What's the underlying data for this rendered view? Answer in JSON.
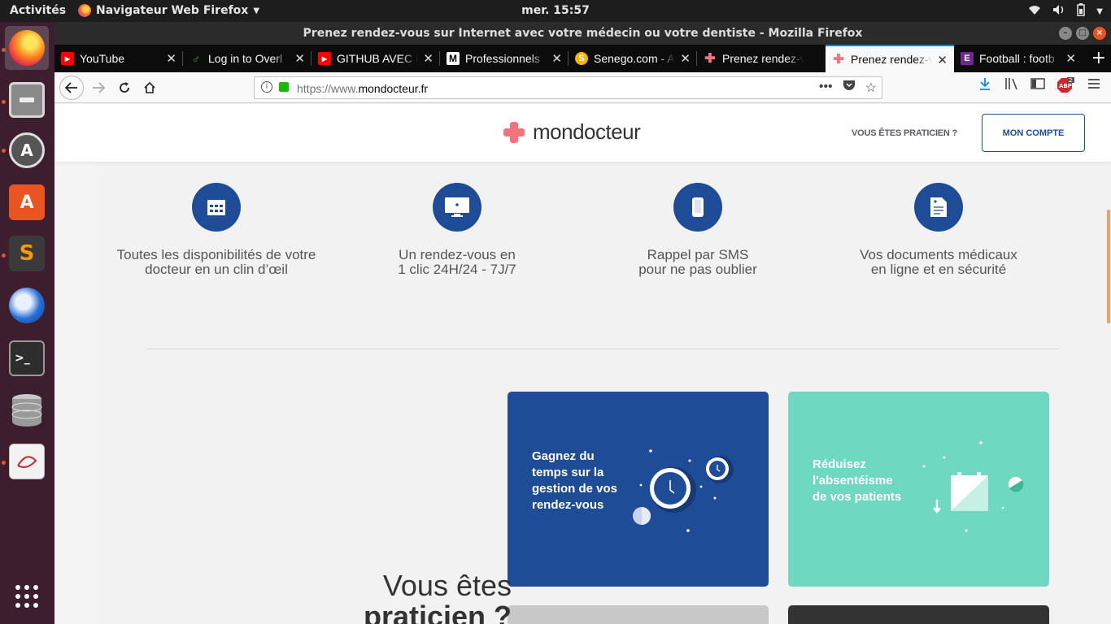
{
  "system": {
    "activities": "Activités",
    "app_menu": "Navigateur Web Firefox",
    "clock": "mer. 15:57"
  },
  "window": {
    "title": "Prenez rendez-vous sur Internet avec votre médecin ou votre dentiste - Mozilla Firefox"
  },
  "tabs": [
    {
      "label": "YouTube",
      "icon": "youtube-icon",
      "color": "#ff0000"
    },
    {
      "label": "Log in to Overl",
      "icon": "overleaf-icon",
      "color": "#4f9c45"
    },
    {
      "label": "GITHUB AVEC L",
      "icon": "youtube-icon",
      "color": "#ff0000"
    },
    {
      "label": "Professionnels",
      "icon": "medium-icon",
      "color": "#ffffff"
    },
    {
      "label": "Senego.com - A",
      "icon": "senego-icon",
      "color": "#f5b800"
    },
    {
      "label": "Prenez rendez-v",
      "icon": "mondocteur-icon",
      "color": "#f4727e"
    },
    {
      "label": "Prenez rendez-v",
      "icon": "mondocteur-icon",
      "color": "#f4727e"
    },
    {
      "label": "Football : footb",
      "icon": "football-icon",
      "color": "#6d2b8f"
    }
  ],
  "url": {
    "prefix": "https://www.",
    "host": "mondocteur.fr"
  },
  "site": {
    "brand": "mondocteur",
    "praticien_link": "VOUS ÊTES PRATICIEN ?",
    "account_button": "MON COMPTE",
    "features": [
      {
        "line1": "Toutes les disponibilités de votre",
        "line2": "docteur en un clin d’œil",
        "icon": "calendar-icon"
      },
      {
        "line1": "Un rendez-vous en",
        "line2": "1 clic 24H/24 - 7J/7",
        "icon": "monitor-icon"
      },
      {
        "line1": "Rappel par SMS",
        "line2": "pour ne pas oublier",
        "icon": "phone-icon"
      },
      {
        "line1": "Vos documents médicaux",
        "line2": "en ligne et en sécurité",
        "icon": "document-icon"
      }
    ],
    "cards": [
      {
        "text": "Gagnez du temps sur la gestion de vos rendez-vous",
        "color": "#1f4c96",
        "icon": "clock-illustration"
      },
      {
        "text": "Réduisez l'absentéisme de vos patients",
        "color": "#6fd8c0",
        "icon": "calendar-illustration"
      }
    ],
    "praticien_title_line1": "Vous êtes",
    "praticien_title_line2": "praticien ?"
  },
  "colors": {
    "brand_blue": "#1f4c96",
    "brand_pink": "#f4727e",
    "mint": "#6fd8c0"
  }
}
